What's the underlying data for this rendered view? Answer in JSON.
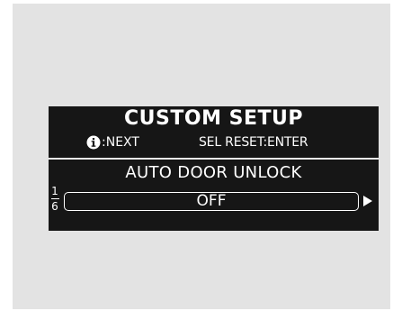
{
  "screen": {
    "title": "CUSTOM SETUP",
    "hint_next": ":NEXT",
    "hint_reset": "SEL RESET:ENTER",
    "item_title": "AUTO DOOR UNLOCK",
    "page_current": "1",
    "page_total": "6",
    "value": "OFF"
  },
  "icons": {
    "info": "info-icon",
    "next": "right-arrow-icon"
  },
  "colors": {
    "screen_bg": "#161616",
    "text": "#ffffff",
    "panel_bg": "#e3e3e3"
  }
}
